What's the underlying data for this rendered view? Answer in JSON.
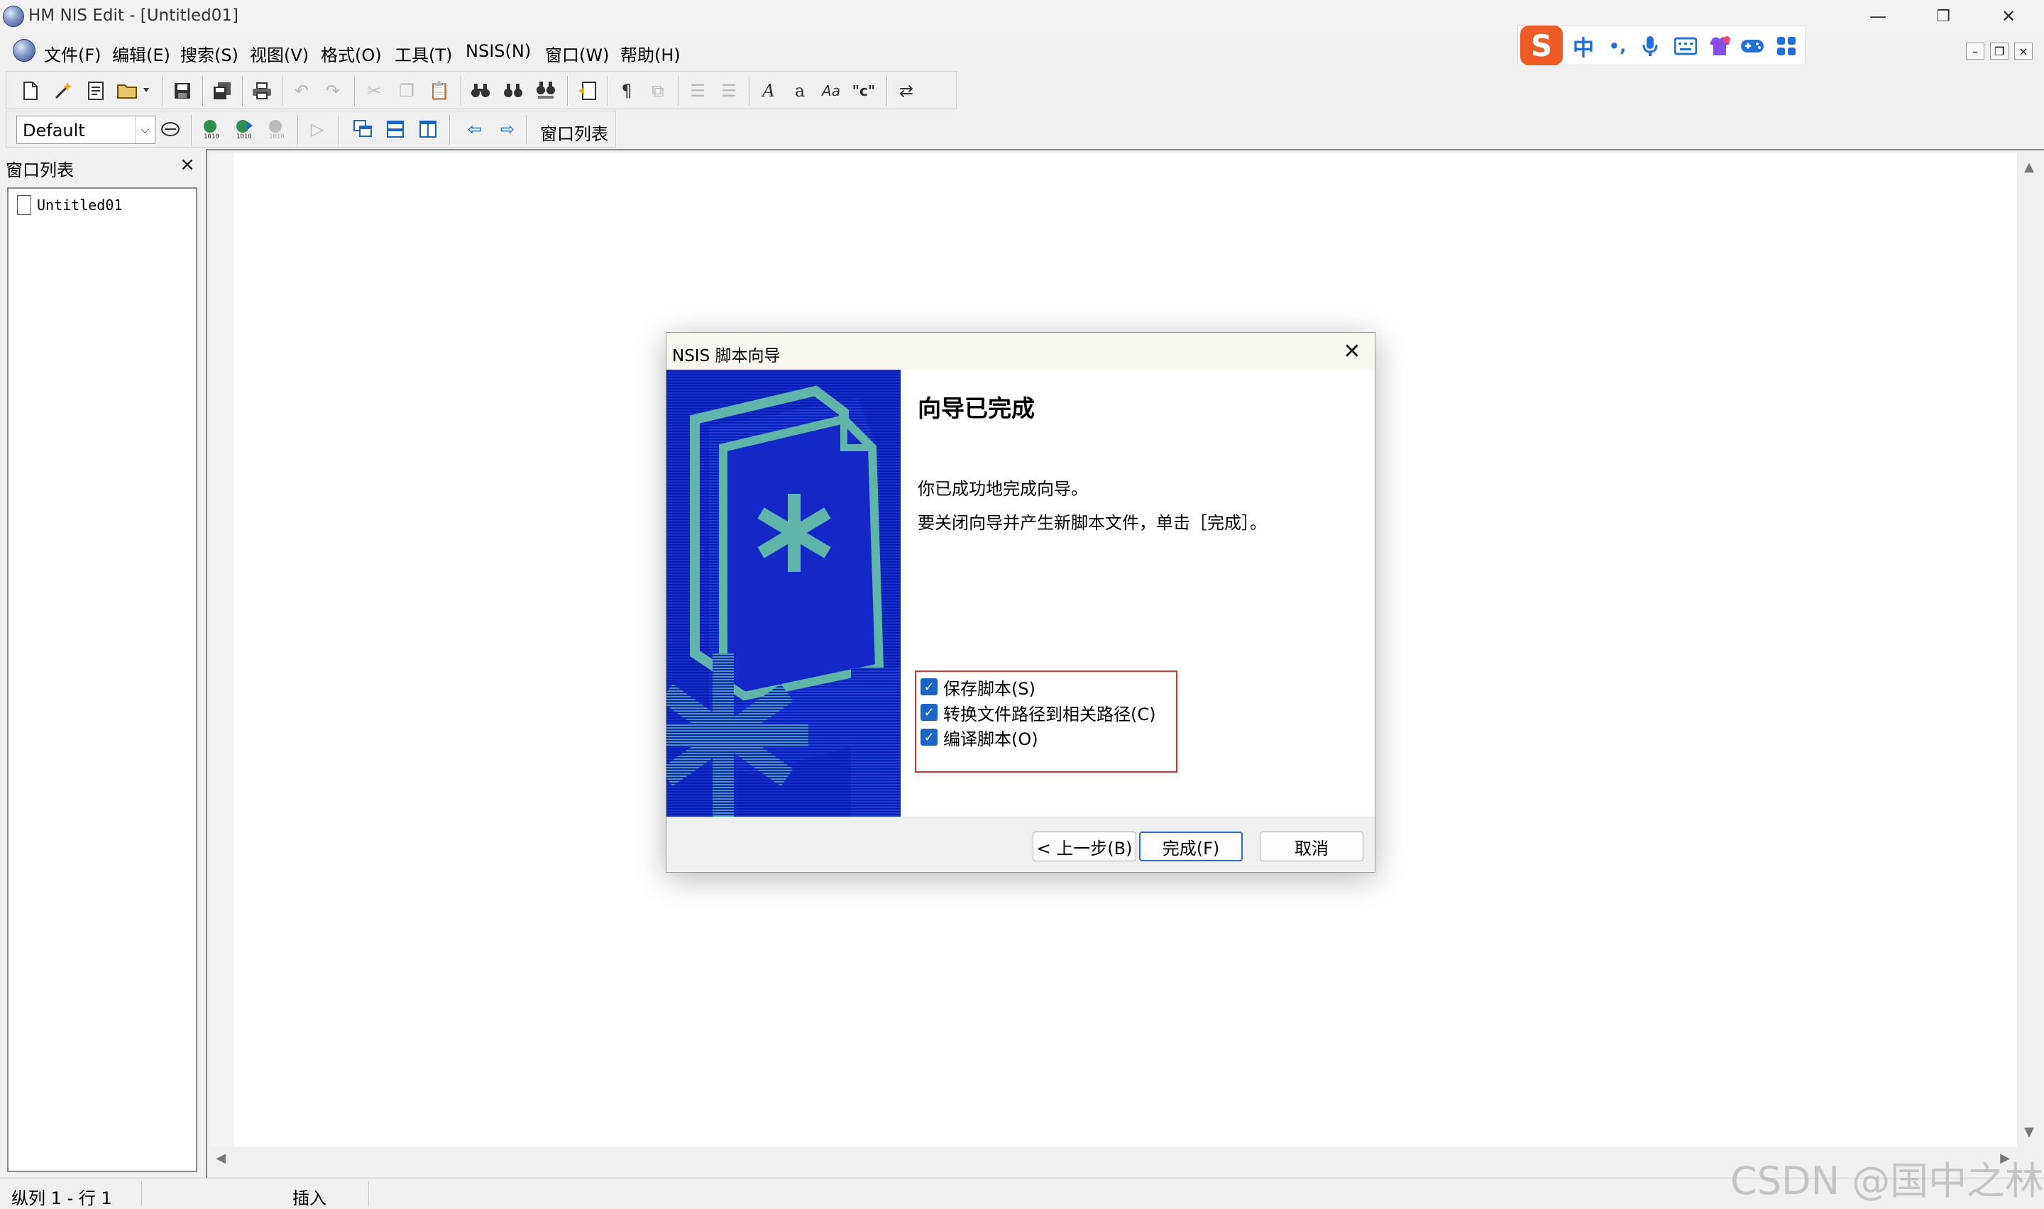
{
  "window": {
    "title": "HM NIS Edit - [Untitled01]",
    "minimize": "—",
    "restore": "❐",
    "close": "✕"
  },
  "menu": {
    "items": [
      "文件(F)",
      "编辑(E)",
      "搜索(S)",
      "视图(V)",
      "格式(O)",
      "工具(T)",
      "NSIS(N)",
      "窗口(W)",
      "帮助(H)"
    ],
    "mdi_min": "–",
    "mdi_restore": "❐",
    "mdi_close": "×"
  },
  "ime": {
    "logo": "S",
    "mode": "中",
    "punct": "•,",
    "icons": [
      "mic-icon",
      "keyboard-icon",
      "skin-icon",
      "game-icon",
      "apps-icon"
    ]
  },
  "toolbar": {
    "style_select_value": "Default",
    "window_list_button": "窗口列表"
  },
  "sidebar": {
    "title": "窗口列表",
    "close": "×",
    "items": [
      "Untitled01"
    ]
  },
  "status": {
    "position": "纵列 1 - 行 1",
    "mode": "插入"
  },
  "watermark": "CSDN @国中之林",
  "dialog": {
    "title": "NSIS 脚本向导",
    "close": "✕",
    "heading": "向导已完成",
    "line1": "你已成功地完成向导。",
    "line2": "要关闭向导并产生新脚本文件，单击［完成］。",
    "options": [
      {
        "label": "保存脚本(S)",
        "checked": true
      },
      {
        "label": "转换文件路径到相关路径(C)",
        "checked": true
      },
      {
        "label": "编译脚本(O)",
        "checked": true
      }
    ],
    "buttons": {
      "back": "< 上一步(B)",
      "finish": "完成(F)",
      "cancel": "取消"
    },
    "accent": "#e03030",
    "banner_color": "#0a1cb4"
  }
}
